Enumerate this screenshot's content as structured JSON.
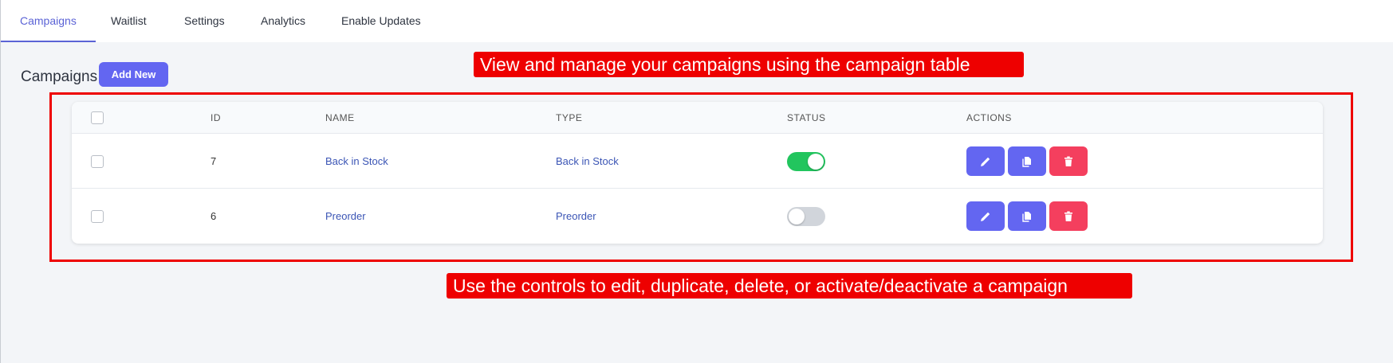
{
  "tabs": [
    {
      "label": "Campaigns",
      "active": true
    },
    {
      "label": "Waitlist",
      "active": false
    },
    {
      "label": "Settings",
      "active": false
    },
    {
      "label": "Analytics",
      "active": false
    },
    {
      "label": "Enable Updates",
      "active": false
    }
  ],
  "section": {
    "title": "Campaigns",
    "add_new_label": "Add New"
  },
  "annotations": {
    "top": "View and manage your campaigns using the campaign table",
    "bottom": "Use the controls to edit, duplicate, delete, or activate/deactivate a campaign"
  },
  "table": {
    "columns": [
      "ID",
      "NAME",
      "TYPE",
      "STATUS",
      "ACTIONS"
    ],
    "rows": [
      {
        "id": "7",
        "name": "Back in Stock",
        "type": "Back in Stock",
        "status": "on"
      },
      {
        "id": "6",
        "name": "Preorder",
        "type": "Preorder",
        "status": "off"
      }
    ]
  },
  "colors": {
    "accent": "#6366f1",
    "toggle_on": "#22c55e",
    "toggle_off": "#d1d5db",
    "delete": "#f43f5e",
    "annotation": "#ee0000"
  },
  "icons": {
    "edit": "pencil-icon",
    "duplicate": "copy-icon",
    "delete": "trash-icon"
  }
}
